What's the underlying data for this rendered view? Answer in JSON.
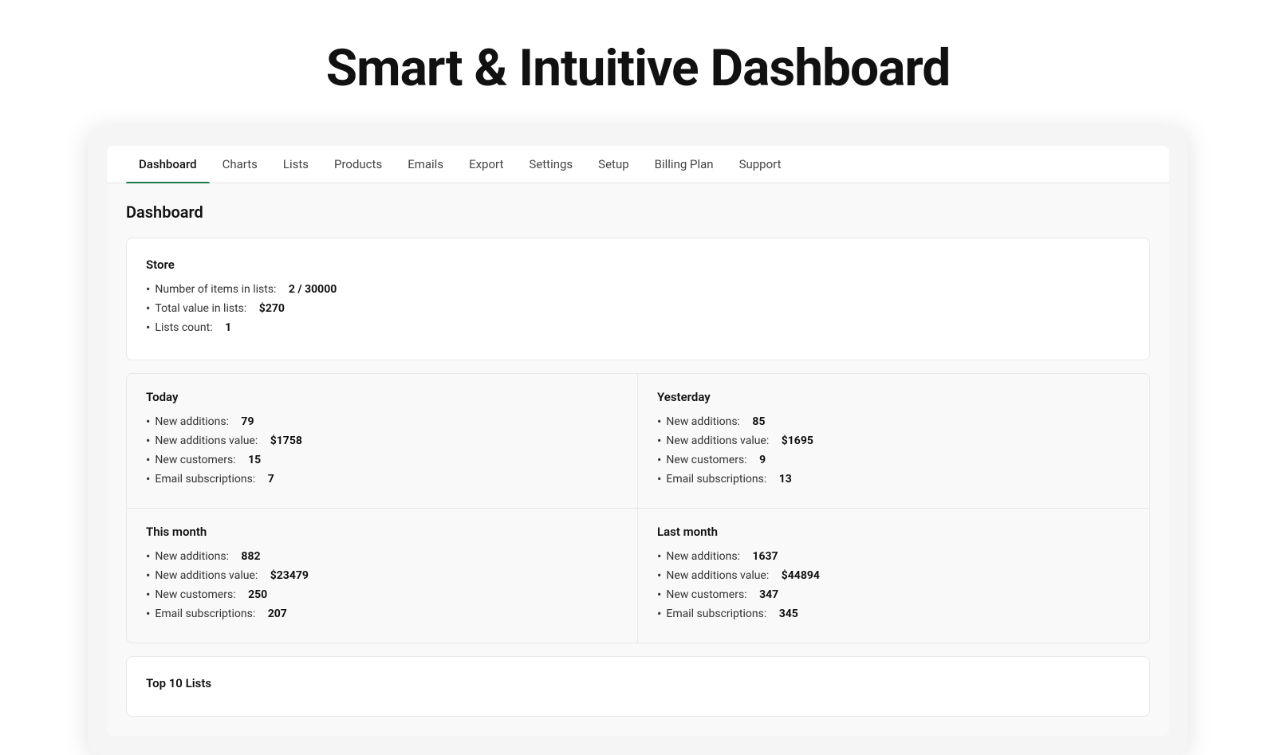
{
  "headline": "Smart & Intuitive Dashboard",
  "nav": {
    "items": [
      {
        "label": "Dashboard",
        "active": true
      },
      {
        "label": "Charts",
        "active": false
      },
      {
        "label": "Lists",
        "active": false
      },
      {
        "label": "Products",
        "active": false
      },
      {
        "label": "Emails",
        "active": false
      },
      {
        "label": "Export",
        "active": false
      },
      {
        "label": "Settings",
        "active": false
      },
      {
        "label": "Setup",
        "active": false
      },
      {
        "label": "Billing Plan",
        "active": false
      },
      {
        "label": "Support",
        "active": false
      }
    ]
  },
  "page_heading": "Dashboard",
  "store": {
    "title": "Store",
    "items_in_lists_label": "Number of items in lists:",
    "items_in_lists_value": "2 / 30000",
    "total_value_label": "Total value in lists:",
    "total_value_value": "$270",
    "lists_count_label": "Lists count:",
    "lists_count_value": "1"
  },
  "today": {
    "title": "Today",
    "new_additions_label": "New additions:",
    "new_additions_value": "79",
    "new_additions_value_label": "New additions value:",
    "new_additions_value_value": "$1758",
    "new_customers_label": "New customers:",
    "new_customers_value": "15",
    "email_subscriptions_label": "Email subscriptions:",
    "email_subscriptions_value": "7"
  },
  "yesterday": {
    "title": "Yesterday",
    "new_additions_label": "New additions:",
    "new_additions_value": "85",
    "new_additions_value_label": "New additions value:",
    "new_additions_value_value": "$1695",
    "new_customers_label": "New customers:",
    "new_customers_value": "9",
    "email_subscriptions_label": "Email subscriptions:",
    "email_subscriptions_value": "13"
  },
  "this_month": {
    "title": "This month",
    "new_additions_label": "New additions:",
    "new_additions_value": "882",
    "new_additions_value_label": "New additions value:",
    "new_additions_value_value": "$23479",
    "new_customers_label": "New customers:",
    "new_customers_value": "250",
    "email_subscriptions_label": "Email subscriptions:",
    "email_subscriptions_value": "207"
  },
  "last_month": {
    "title": "Last month",
    "new_additions_label": "New additions:",
    "new_additions_value": "1637",
    "new_additions_value_label": "New additions value:",
    "new_additions_value_value": "$44894",
    "new_customers_label": "New customers:",
    "new_customers_value": "347",
    "email_subscriptions_label": "Email subscriptions:",
    "email_subscriptions_value": "345"
  },
  "top_lists": {
    "title": "Top 10 Lists"
  },
  "colors": {
    "active_nav_underline": "#1a7a4a"
  }
}
